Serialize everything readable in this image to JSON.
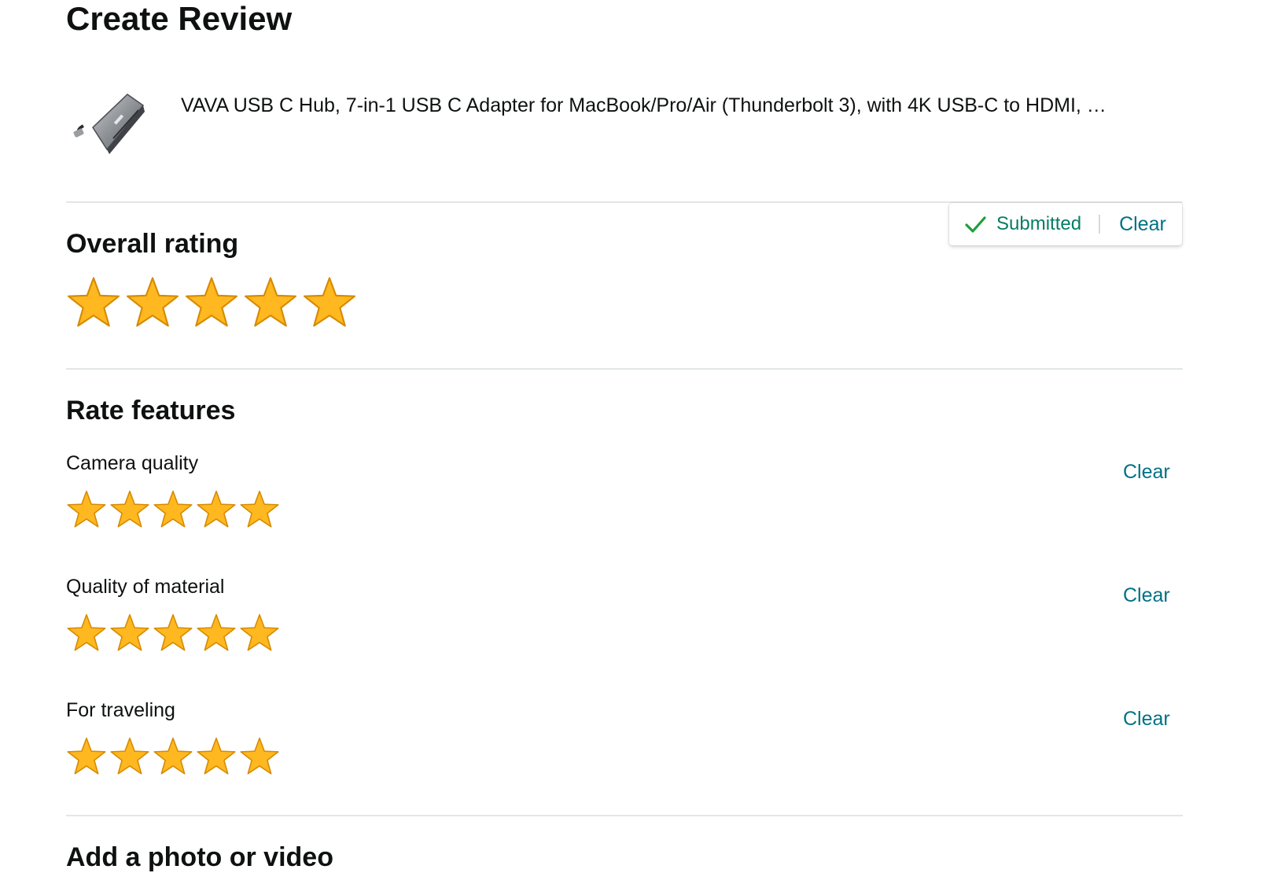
{
  "page": {
    "title": "Create Review"
  },
  "product": {
    "title": "VAVA USB C Hub, 7-in-1 USB C Adapter for MacBook/Pro/Air (Thunderbolt 3), with 4K USB-C to HDMI, …"
  },
  "overall": {
    "heading": "Overall rating",
    "status": "Submitted",
    "clear_label": "Clear",
    "rating": 5,
    "max_rating": 5
  },
  "features": {
    "heading": "Rate features",
    "items": [
      {
        "label": "Camera quality",
        "clear_label": "Clear",
        "rating": 5
      },
      {
        "label": "Quality of material",
        "clear_label": "Clear",
        "rating": 5
      },
      {
        "label": "For traveling",
        "clear_label": "Clear",
        "rating": 5
      }
    ]
  },
  "media": {
    "heading": "Add a photo or video"
  },
  "colors": {
    "star_fill": "#FFB820",
    "star_stroke": "#D68A00",
    "link": "#007185",
    "success": "#067D62"
  },
  "icons": {
    "status": "check-icon",
    "rating": "star-icon"
  }
}
